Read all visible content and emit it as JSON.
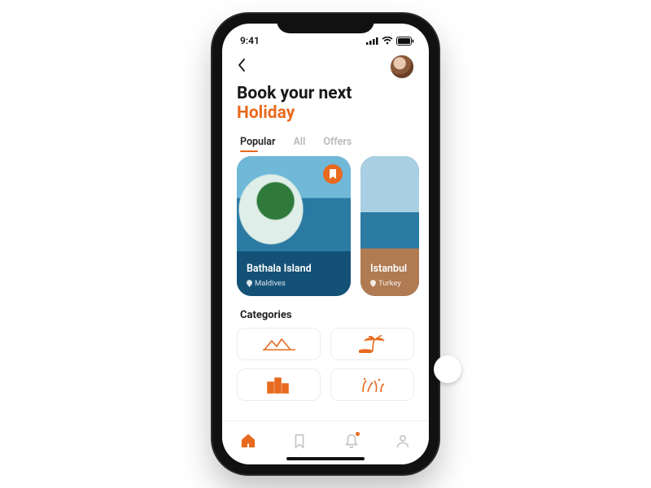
{
  "status": {
    "time": "9:41"
  },
  "header": {
    "title_line1": "Book your next",
    "title_line2": "Holiday"
  },
  "tabs": [
    {
      "label": "Popular",
      "active": true
    },
    {
      "label": "All",
      "active": false
    },
    {
      "label": "Offers",
      "active": false
    }
  ],
  "cards": [
    {
      "title": "Bathala Island",
      "location": "Maldives",
      "bookmarked": true
    },
    {
      "title": "Istanbul",
      "location": "Turkey",
      "bookmarked": false
    }
  ],
  "sections": {
    "categories_title": "Categories"
  },
  "categories": [
    {
      "name": "mountains"
    },
    {
      "name": "beach"
    },
    {
      "name": "city"
    },
    {
      "name": "diving"
    }
  ],
  "nav": [
    {
      "name": "home",
      "active": true
    },
    {
      "name": "bookmarks",
      "active": false
    },
    {
      "name": "notifications",
      "active": false,
      "badge": true
    },
    {
      "name": "profile",
      "active": false
    }
  ],
  "colors": {
    "accent": "#e86a1f"
  }
}
